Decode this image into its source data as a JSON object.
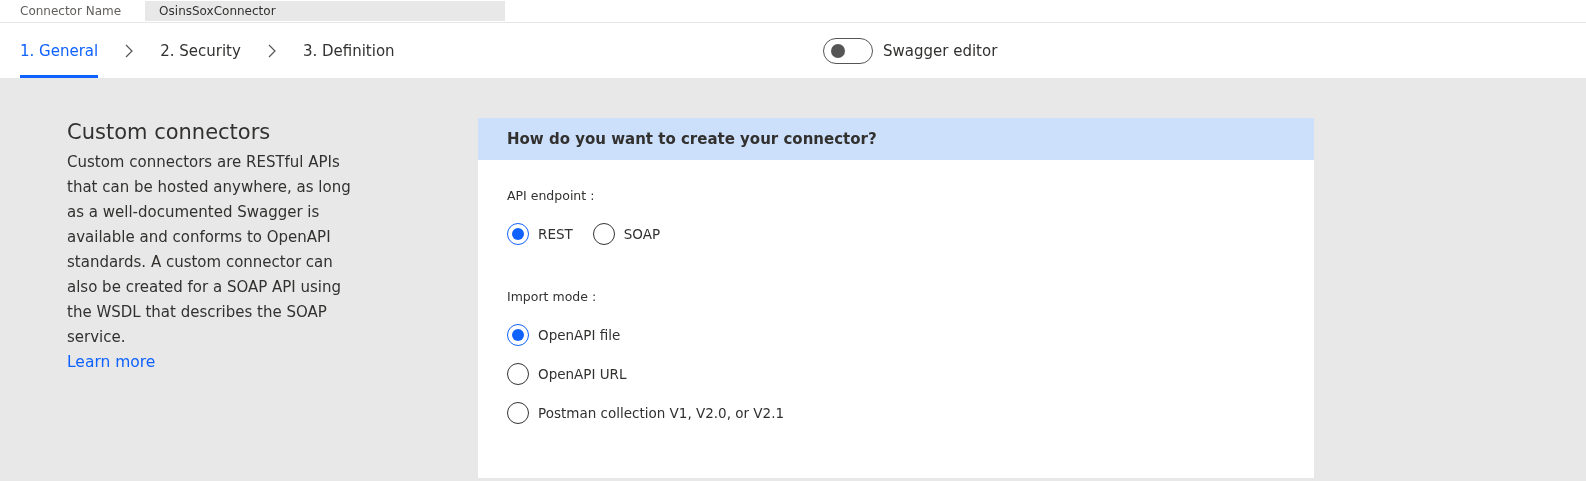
{
  "connector_name": {
    "label": "Connector Name",
    "value": "OsinsSoxConnector"
  },
  "steps": [
    {
      "label": "1. General",
      "selected": true
    },
    {
      "label": "2. Security",
      "selected": false
    },
    {
      "label": "3. Definition",
      "selected": false
    }
  ],
  "swagger_editor": {
    "label": "Swagger editor",
    "on": false
  },
  "intro": {
    "title": "Custom connectors",
    "body": "Custom connectors are RESTful APIs that can be hosted anywhere, as long as a well-documented Swagger is available and conforms to OpenAPI standards. A custom connector can also be created for a SOAP API using the WSDL that describes the SOAP service.",
    "link": "Learn more"
  },
  "card": {
    "title": "How do you want to create your connector?",
    "groups": [
      {
        "label": "API endpoint :",
        "kind": "inline",
        "options": [
          {
            "label": "REST",
            "selected": true
          },
          {
            "label": "SOAP",
            "selected": false
          }
        ]
      },
      {
        "label": "Import mode :",
        "kind": "stacked",
        "options": [
          {
            "label": "OpenAPI file",
            "selected": true
          },
          {
            "label": "OpenAPI URL",
            "selected": false
          },
          {
            "label": "Postman collection V1, V2.0, or V2.1",
            "selected": false
          }
        ]
      }
    ]
  }
}
